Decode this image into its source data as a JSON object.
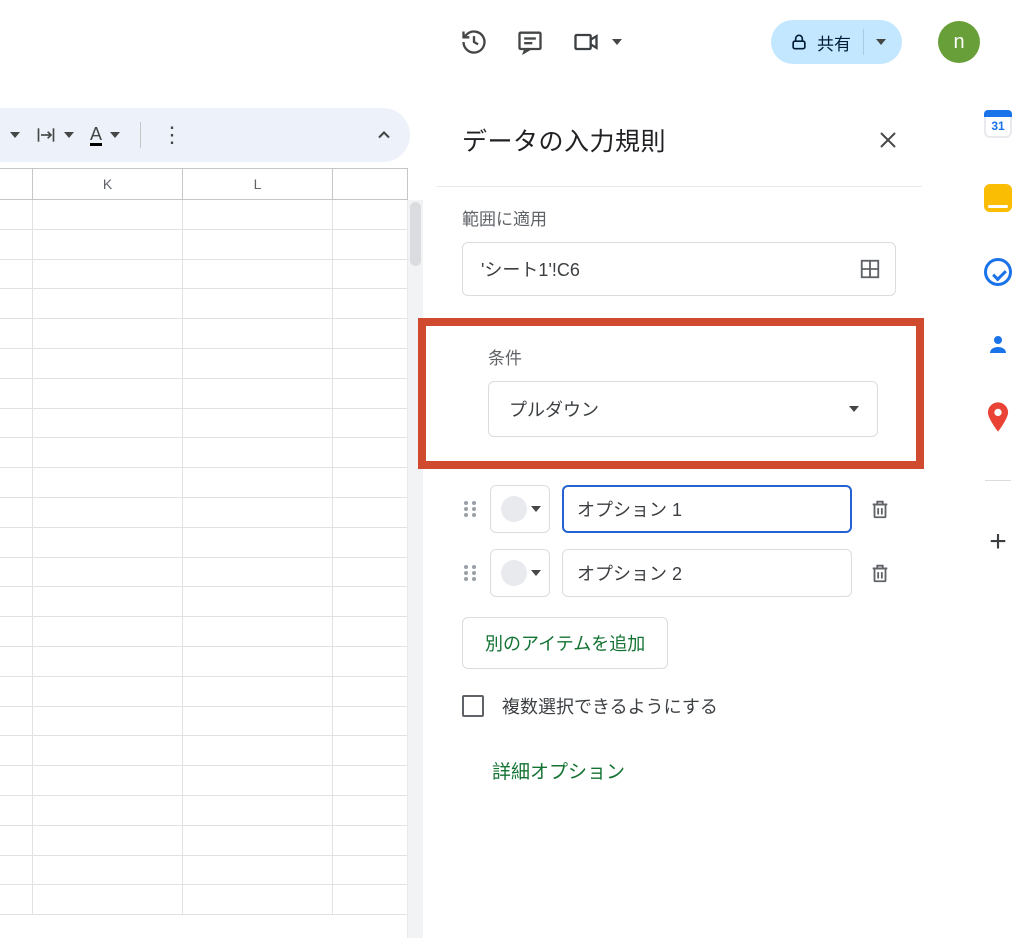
{
  "topbar": {
    "share_label": "共有",
    "avatar_letter": "n"
  },
  "toolbar": {},
  "sheet": {
    "columns": [
      "",
      "K",
      "L"
    ],
    "row_count": 24
  },
  "panel": {
    "title": "データの入力規則",
    "range_label": "範囲に適用",
    "range_value": "'シート1'!C6",
    "criteria_label": "条件",
    "criteria_value": "プルダウン",
    "options": [
      {
        "value": "オプション 1",
        "focused": true
      },
      {
        "value": "オプション 2",
        "focused": false
      }
    ],
    "add_item_label": "別のアイテムを追加",
    "multi_select_label": "複数選択できるようにする",
    "advanced_label": "詳細オプション"
  },
  "rail": {
    "calendar_day": "31"
  }
}
